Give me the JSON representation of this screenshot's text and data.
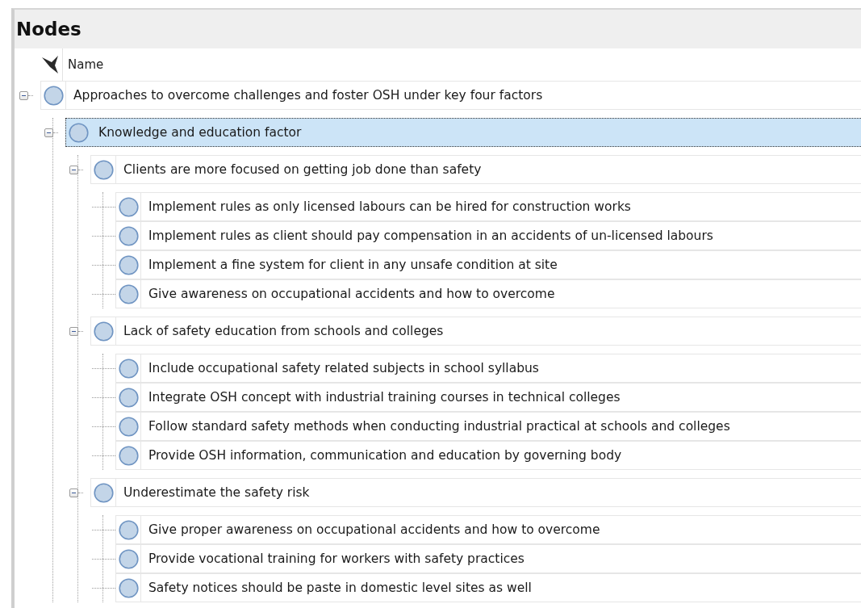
{
  "panel": {
    "title": "Nodes"
  },
  "header": {
    "column": "Name"
  },
  "tree": [
    {
      "label": "Approaches to overcome challenges and foster OSH under key four factors",
      "expanded": true,
      "selected": false,
      "children": [
        {
          "label": "Knowledge and education factor",
          "expanded": true,
          "selected": true,
          "children": [
            {
              "label": "Clients are more focused on getting job done than safety",
              "expanded": true,
              "selected": false,
              "children": [
                {
                  "label": "Implement rules as only licensed labours can be hired for construction works",
                  "selected": false
                },
                {
                  "label": "Implement rules as client should pay compensation in an accidents of un-licensed labours",
                  "selected": false
                },
                {
                  "label": "Implement a fine system for client in any unsafe condition at site",
                  "selected": false
                },
                {
                  "label": "Give awareness on occupational accidents and how to overcome",
                  "selected": false
                }
              ]
            },
            {
              "label": "Lack of safety education from schools and colleges",
              "expanded": true,
              "selected": false,
              "children": [
                {
                  "label": "Include occupational safety related subjects in school syllabus",
                  "selected": false
                },
                {
                  "label": "Integrate OSH concept with industrial training courses in technical colleges",
                  "selected": false
                },
                {
                  "label": "Follow standard safety methods when conducting industrial practical at schools and colleges",
                  "selected": false
                },
                {
                  "label": "Provide OSH information, communication and education by governing body",
                  "selected": false
                }
              ]
            },
            {
              "label": "Underestimate the safety risk",
              "expanded": true,
              "selected": false,
              "children": [
                {
                  "label": "Give proper awareness on occupational accidents and how to overcome",
                  "selected": false
                },
                {
                  "label": "Provide vocational training for workers with safety practices",
                  "selected": false
                },
                {
                  "label": "Safety notices should be paste in domestic level sites as well",
                  "selected": false
                }
              ]
            }
          ]
        }
      ]
    }
  ]
}
